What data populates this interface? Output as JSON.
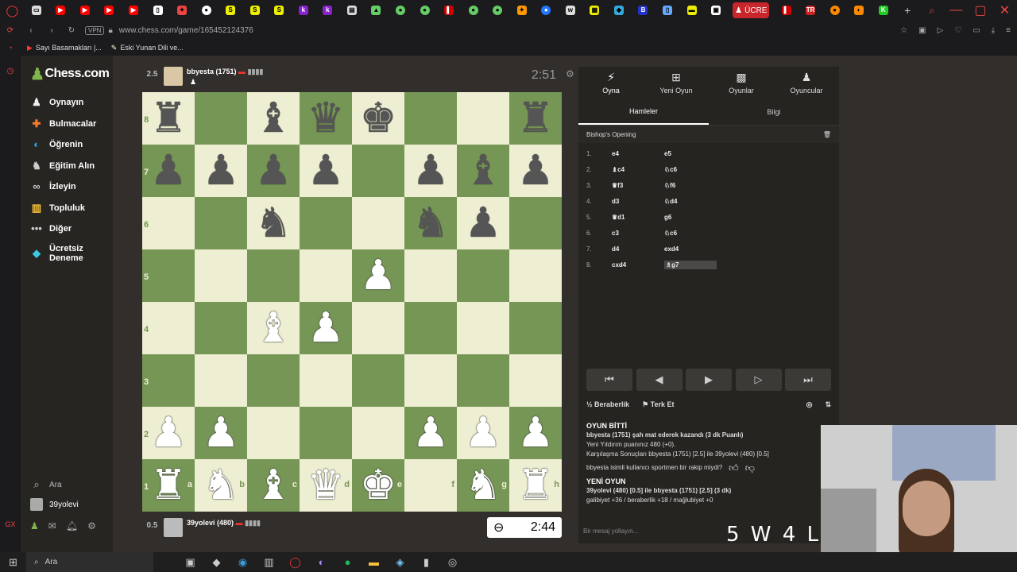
{
  "browser": {
    "url": "www.chess.com/game/165452124376",
    "active_tab": "ÜCRE",
    "bookmarks": [
      "Sayı Basamakları |...",
      "Eski Yunan Dili ve..."
    ],
    "vpn": "VPN"
  },
  "nav": {
    "logo": "Chess.com",
    "items": [
      "Oynayın",
      "Bulmacalar",
      "Öğrenin",
      "Eğitim Alın",
      "İzleyin",
      "Topluluk",
      "Diğer",
      "Ücretsiz Deneme"
    ],
    "search": "Ara",
    "user": "39yolevi"
  },
  "top_player": {
    "score": "2.5",
    "name": "bbyesta (1751)",
    "clock": "2:51"
  },
  "bottom_player": {
    "score": "0.5",
    "name": "39yolevi (480)",
    "clock": "2:44"
  },
  "board": {
    "ranks": [
      "8",
      "7",
      "6",
      "5",
      "4",
      "3",
      "2",
      "1"
    ],
    "files": [
      "a",
      "b",
      "c",
      "d",
      "e",
      "f",
      "g",
      "h"
    ],
    "pieces": [
      [
        "r",
        "",
        "b",
        "q",
        "k",
        "",
        "",
        "r"
      ],
      [
        "p",
        "p",
        "p",
        "p",
        "",
        "p",
        "b",
        "p"
      ],
      [
        "",
        "",
        "n",
        "",
        "",
        "n",
        "p",
        ""
      ],
      [
        "",
        "",
        "",
        "",
        "P",
        "",
        "",
        ""
      ],
      [
        "",
        "",
        "B",
        "P",
        "",
        "",
        "",
        ""
      ],
      [
        "",
        "",
        "",
        "",
        "",
        "",
        "",
        ""
      ],
      [
        "P",
        "P",
        "",
        "",
        "",
        "P",
        "P",
        "P"
      ],
      [
        "R",
        "N",
        "B",
        "Q",
        "K",
        "",
        "N",
        "R"
      ]
    ]
  },
  "panel": {
    "tabs": [
      "Oyna",
      "Yeni Oyun",
      "Oyunlar",
      "Oyuncular"
    ],
    "subtabs": [
      "Hamleler",
      "Bilgi"
    ],
    "opening": "Bishop's Opening",
    "moves": [
      {
        "n": "1.",
        "w": "e4",
        "b": "e5"
      },
      {
        "n": "2.",
        "w": "♝c4",
        "b": "♘c6"
      },
      {
        "n": "3.",
        "w": "♛f3",
        "b": "♘f6"
      },
      {
        "n": "4.",
        "w": "d3",
        "b": "♘d4"
      },
      {
        "n": "5.",
        "w": "♛d1",
        "b": "g6"
      },
      {
        "n": "6.",
        "w": "c3",
        "b": "♘c6"
      },
      {
        "n": "7.",
        "w": "d4",
        "b": "exd4"
      },
      {
        "n": "8.",
        "w": "cxd4",
        "b": "♗g7"
      }
    ],
    "actions": [
      "Beraberlik",
      "Terk Et"
    ],
    "result_title": "OYUN BİTTİ",
    "result_lines": [
      "bbyesta (1751) şah mat ederek kazandı (3 dk Puanlı)",
      "Yeni Yıldırım puanınız 480 (+0).",
      "Karşılaşma Sonuçları bbyesta (1751) [2.5] ile 39yolevi (480) [0.5]",
      "bbyesta isimli kullanıcı sportmen bir rakip miydi?"
    ],
    "new_game_title": "YENİ OYUN",
    "new_game_lines": [
      "39yolevi (480) [0.5] ile bbyesta (1751) [2.5] (3 dk)",
      "galibiyet +36 / beraberlik +18 / mağlubiyet +0"
    ],
    "chat_placeholder": "Bir mesaj yollayın..."
  },
  "overlay_text": "5 W 4 L",
  "taskbar": {
    "search": "Ara"
  }
}
